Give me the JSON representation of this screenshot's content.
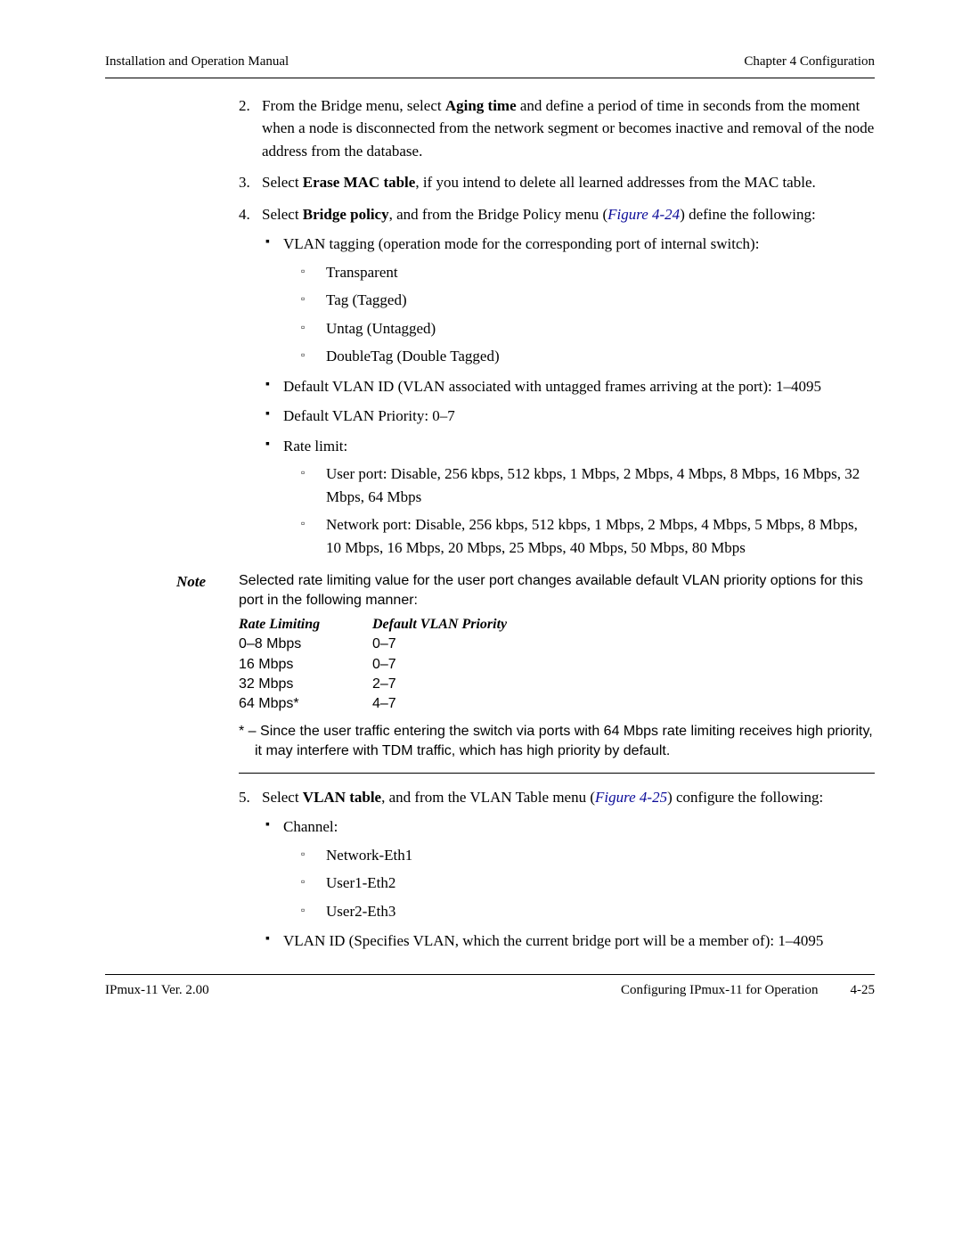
{
  "header": {
    "left": "Installation and Operation Manual",
    "right": "Chapter 4  Configuration"
  },
  "items": {
    "i2": {
      "num": "2.",
      "pre": "From the Bridge menu, select ",
      "bold": "Aging time",
      "post": " and define a period of time in seconds from the moment when a node is disconnected from the network segment or becomes inactive and removal of the node address from the database."
    },
    "i3": {
      "num": "3.",
      "pre": "Select ",
      "bold": "Erase MAC table",
      "post": ", if you intend to delete all learned addresses from the MAC table."
    },
    "i4": {
      "num": "4.",
      "pre": "Select ",
      "bold": "Bridge policy",
      "mid": ", and from the Bridge Policy menu (",
      "link": "Figure 4-24",
      "post": ") define the following:",
      "b1": "VLAN tagging (operation mode for the corresponding port of internal switch):",
      "s1": "Transparent",
      "s2": "Tag (Tagged)",
      "s3": "Untag (Untagged)",
      "s4": "DoubleTag (Double Tagged)",
      "b2": "Default VLAN ID (VLAN associated with untagged frames arriving at the port): 1–4095",
      "b3": "Default VLAN Priority: 0–7",
      "b4": "Rate limit:",
      "r1": "User port: Disable, 256 kbps, 512 kbps, 1 Mbps, 2 Mbps, 4 Mbps, 8 Mbps, 16 Mbps, 32 Mbps, 64 Mbps",
      "r2": "Network port: Disable, 256 kbps, 512 kbps, 1 Mbps, 2 Mbps, 4 Mbps, 5 Mbps, 8 Mbps, 10 Mbps, 16 Mbps, 20 Mbps, 25 Mbps, 40 Mbps, 50 Mbps, 80 Mbps"
    },
    "i5": {
      "num": "5.",
      "pre": "Select ",
      "bold": "VLAN table",
      "mid": ", and from the VLAN Table menu (",
      "link": "Figure 4-25",
      "post": ") configure the following:",
      "b1": "Channel:",
      "c1": "Network-Eth1",
      "c2": "User1-Eth2",
      "c3": "User2-Eth3",
      "b2": "VLAN ID (Specifies VLAN, which the current bridge port will be a member of): 1–4095"
    }
  },
  "note": {
    "label": "Note",
    "intro": "Selected rate limiting value for the user port changes available default VLAN priority options for this port in the following manner:",
    "col1": "Rate Limiting",
    "col2": "Default VLAN Priority",
    "rows": [
      {
        "a": "0–8 Mbps",
        "b": "0–7"
      },
      {
        "a": "16 Mbps",
        "b": "0–7"
      },
      {
        "a": "32 Mbps",
        "b": "2–7"
      },
      {
        "a": "64 Mbps*",
        "b": "4–7"
      }
    ],
    "foot": "*  – Since the user traffic entering the switch via ports with 64 Mbps rate limiting receives high priority, it may interfere with TDM traffic, which has high priority by default."
  },
  "footer": {
    "left": "IPmux-11 Ver. 2.00",
    "center": "Configuring IPmux-11 for Operation",
    "right": "4-25"
  }
}
